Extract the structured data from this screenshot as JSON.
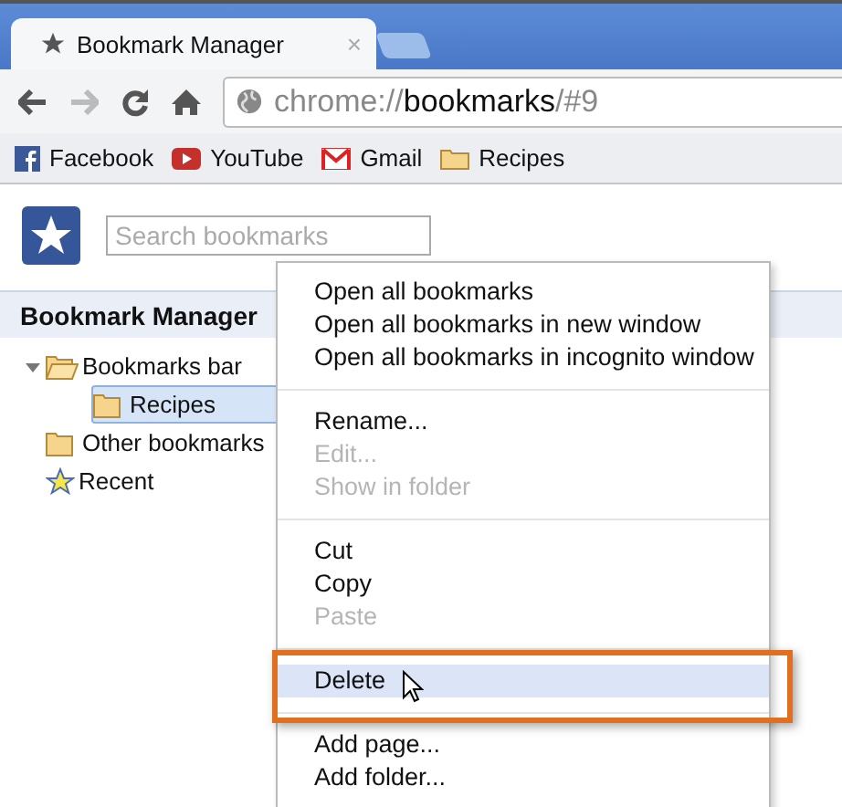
{
  "tabs": [
    {
      "title": "Bookmark Manager",
      "close": "×",
      "selected": true
    },
    {
      "selected": false
    }
  ],
  "address": {
    "scheme": "chrome://",
    "host": "bookmarks",
    "path": "/#9"
  },
  "bookmarks_bar": [
    {
      "label": "Facebook",
      "kind": "facebook"
    },
    {
      "label": "YouTube",
      "kind": "youtube"
    },
    {
      "label": "Gmail",
      "kind": "gmail"
    },
    {
      "label": "Recipes",
      "kind": "folder"
    }
  ],
  "search": {
    "placeholder": "Search bookmarks"
  },
  "header": {
    "title": "Bookmark Manager"
  },
  "tree": [
    {
      "label": "Bookmarks bar",
      "kind": "folder",
      "expanded": true,
      "selected": false,
      "children": [
        {
          "label": "Recipes",
          "kind": "folder",
          "selected": true
        }
      ]
    },
    {
      "label": "Other bookmarks",
      "kind": "folder",
      "selected": false
    },
    {
      "label": "Recent",
      "kind": "star",
      "selected": false
    }
  ],
  "context_menu": [
    {
      "kind": "item",
      "label": "Open all bookmarks",
      "disabled": false,
      "highlighted": false
    },
    {
      "kind": "item",
      "label": "Open all bookmarks in new window",
      "disabled": false,
      "highlighted": false
    },
    {
      "kind": "item",
      "label": "Open all bookmarks in incognito window",
      "disabled": false,
      "highlighted": false
    },
    {
      "kind": "separator"
    },
    {
      "kind": "item",
      "label": "Rename...",
      "disabled": false,
      "highlighted": false
    },
    {
      "kind": "item",
      "label": "Edit...",
      "disabled": true,
      "highlighted": false
    },
    {
      "kind": "item",
      "label": "Show in folder",
      "disabled": true,
      "highlighted": false
    },
    {
      "kind": "separator"
    },
    {
      "kind": "item",
      "label": "Cut",
      "disabled": false,
      "highlighted": false
    },
    {
      "kind": "item",
      "label": "Copy",
      "disabled": false,
      "highlighted": false
    },
    {
      "kind": "item",
      "label": "Paste",
      "disabled": true,
      "highlighted": false
    },
    {
      "kind": "separator"
    },
    {
      "kind": "item",
      "label": "Delete",
      "disabled": false,
      "highlighted": true
    },
    {
      "kind": "separator"
    },
    {
      "kind": "item",
      "label": "Add page...",
      "disabled": false,
      "highlighted": false
    },
    {
      "kind": "item",
      "label": "Add folder...",
      "disabled": false,
      "highlighted": false
    }
  ]
}
